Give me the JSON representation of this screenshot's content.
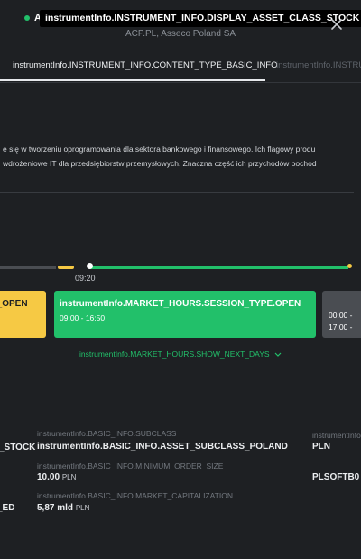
{
  "header": {
    "title_visible": "A",
    "tooltip": "instrumentInfo.INSTRUMENT_INFO.DISPLAY_ASSET_CLASS_STOCK",
    "subtitle": "ACP.PL, Asseco Poland SA"
  },
  "tabs": [
    {
      "label": "instrumentInfo.INSTRUMENT_INFO.CONTENT_TYPE_BASIC_INFO",
      "active": true
    },
    {
      "label": "instrumentInfo.INSTRUMENT_INFO.",
      "active": false
    }
  ],
  "description": {
    "line1": "e się w tworzeniu oprogramowania dla sektora bankowego i finansowego. Ich flagowy produ",
    "line2": "wdrożeniowe IT dla przedsiębiorstw przemysłowych. Znaczna część ich przychodów pochod"
  },
  "timeline": {
    "current_time": "09:20"
  },
  "sessions": [
    {
      "name": "instrumentInfo.MARKET_HOURS.SESSION_TYPE.PRE_OPEN",
      "name_visible": "E_OPEN",
      "time": "",
      "color": "#f6c944"
    },
    {
      "name": "instrumentInfo.MARKET_HOURS.SESSION_TYPE.OPEN",
      "time": "09:00 - 16:50",
      "color": "#22c06a"
    },
    {
      "name": "",
      "time_1": "00:00 -",
      "time_2": "17:00 -",
      "color": "#4a4d52"
    }
  ],
  "show_next_days": "instrumentInfo.MARKET_HOURS.SHOW_NEXT_DAYS",
  "basic_info": {
    "left_col": {
      "value_1": "_STOCK",
      "value_2": "_ED"
    },
    "mid_col": [
      {
        "label": "instrumentInfo.BASIC_INFO.SUBCLASS",
        "value": "instrumentInfo.BASIC_INFO.ASSET_SUBCLASS_POLAND",
        "unit": ""
      },
      {
        "label": "instrumentInfo.BASIC_INFO.MINIMUM_ORDER_SIZE",
        "value": "10.00",
        "unit": "PLN"
      },
      {
        "label": "instrumentInfo.BASIC_INFO.MARKET_CAPITALIZATION",
        "value": "5,87 mld",
        "unit": "PLN"
      }
    ],
    "right_col": [
      {
        "label": "instrumentInfo.B",
        "value": "PLN"
      },
      {
        "label": "",
        "value": "PLSOFTB0"
      }
    ]
  },
  "colors": {
    "background": "#1e2023",
    "green": "#22c06a",
    "yellow": "#f6c944",
    "gray": "#4a4d52"
  }
}
